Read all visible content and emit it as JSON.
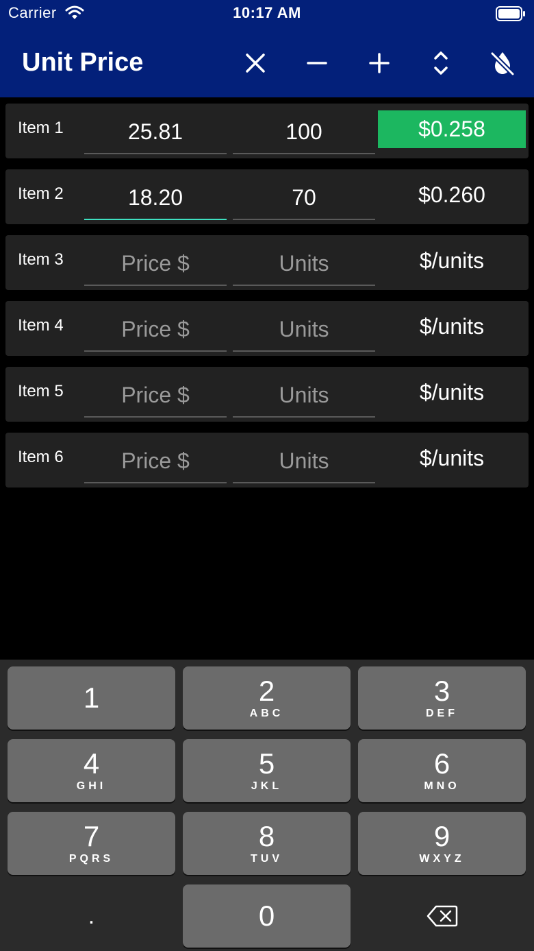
{
  "status": {
    "carrier": "Carrier",
    "time": "10:17 AM"
  },
  "header": {
    "title": "Unit Price",
    "actions": [
      "close-icon",
      "minus-icon",
      "plus-icon",
      "sort-icon",
      "no-water-icon"
    ]
  },
  "rows": [
    {
      "label": "Item 1",
      "price": "25.81",
      "units": "100",
      "result": "$0.258"
    },
    {
      "label": "Item 2",
      "price": "18.20",
      "units": "70",
      "result": "$0.260"
    },
    {
      "label": "Item 3",
      "price_placeholder": "Price $",
      "units_placeholder": "Units",
      "result": "$/units"
    },
    {
      "label": "Item 4",
      "price_placeholder": "Price $",
      "units_placeholder": "Units",
      "result": "$/units"
    },
    {
      "label": "Item 5",
      "price_placeholder": "Price $",
      "units_placeholder": "Units",
      "result": "$/units"
    },
    {
      "label": "Item 6",
      "price_placeholder": "Price $",
      "units_placeholder": "Units",
      "result": "$/units"
    }
  ],
  "colors": {
    "header": "#03207a",
    "best_result": "#1cb760",
    "focus_underline": "#3ee0c0"
  },
  "keypad": {
    "keys": [
      {
        "num": "1",
        "letters": ""
      },
      {
        "num": "2",
        "letters": "ABC"
      },
      {
        "num": "3",
        "letters": "DEF"
      },
      {
        "num": "4",
        "letters": "GHI"
      },
      {
        "num": "5",
        "letters": "JKL"
      },
      {
        "num": "6",
        "letters": "MNO"
      },
      {
        "num": "7",
        "letters": "PQRS"
      },
      {
        "num": "8",
        "letters": "TUV"
      },
      {
        "num": "9",
        "letters": "WXYZ"
      },
      {
        "num": "0",
        "letters": ""
      }
    ],
    "decimal": ".",
    "delete_icon": "backspace-icon"
  }
}
